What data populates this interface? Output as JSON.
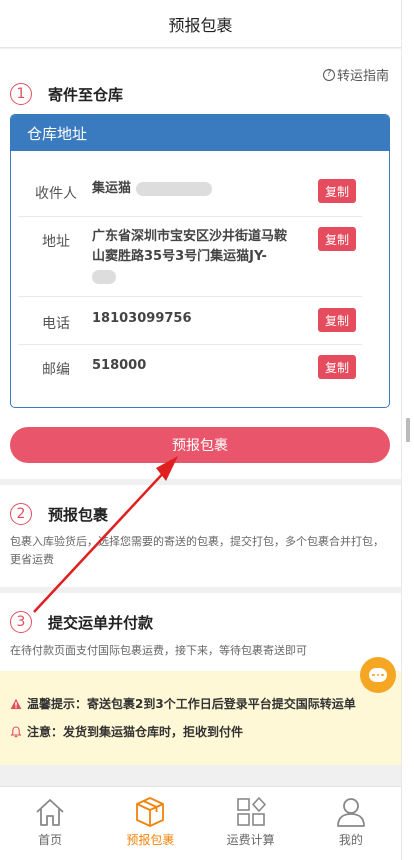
{
  "header": {
    "title": "预报包裹"
  },
  "guide": {
    "label": "转运指南"
  },
  "steps": [
    {
      "num": "1",
      "title": "寄件至仓库"
    },
    {
      "num": "2",
      "title": "预报包裹",
      "desc": "包裹入库验货后，选择您需要的寄送的包裹，提交打包，多个包裹合并打包，更省运费"
    },
    {
      "num": "3",
      "title": "提交运单并付款",
      "desc": "在待付款页面支付国际包裹运费，接下来，等待包裹寄送即可"
    }
  ],
  "warehouse": {
    "title": "仓库地址",
    "rows": [
      {
        "label": "收件人",
        "value": "集运猫"
      },
      {
        "label": "地址",
        "value": "广东省深圳市宝安区沙井街道马鞍山窦胜路35号3号门集运猫JY-"
      },
      {
        "label": "电话",
        "value": "18103099756"
      },
      {
        "label": "邮编",
        "value": "518000"
      }
    ],
    "copy_label": "复制"
  },
  "primary_button": {
    "label": "预报包裹"
  },
  "tips": [
    {
      "icon": "warning-icon",
      "text": "温馨提示：寄送包裹2到3个工作日后登录平台提交国际转运单"
    },
    {
      "icon": "bell-icon",
      "text": "注意：发货到集运猫仓库时，拒收到付件"
    }
  ],
  "tabs": [
    {
      "label": "首页",
      "icon": "home-icon"
    },
    {
      "label": "预报包裹",
      "icon": "box-icon",
      "active": true
    },
    {
      "label": "运费计算",
      "icon": "grid-icon"
    },
    {
      "label": "我的",
      "icon": "user-icon"
    }
  ],
  "colors": {
    "accent_red": "#e54d5e",
    "card_blue": "#3a7bbf",
    "active_orange": "#f0830a",
    "tip_bg": "#fff8d6"
  }
}
